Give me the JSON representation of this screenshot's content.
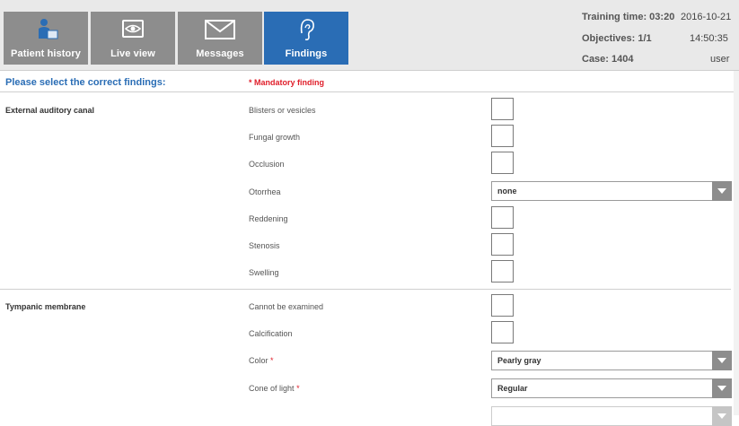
{
  "tabs": [
    {
      "label": "Patient history",
      "icon": "patient-history-icon",
      "active": false
    },
    {
      "label": "Live view",
      "icon": "eye-icon",
      "active": false
    },
    {
      "label": "Messages",
      "icon": "envelope-icon",
      "active": false
    },
    {
      "label": "Findings",
      "icon": "ear-icon",
      "active": true
    }
  ],
  "status": {
    "training_time_label": "Training time: 03:20",
    "date": "2016-10-21",
    "objectives_label": "Objectives: 1/1",
    "time": "14:50:35",
    "case_label": "Case: 1404",
    "user": "user"
  },
  "findings": {
    "title": "Please select the correct findings:",
    "mandatory_note": "* Mandatory finding",
    "sections": [
      {
        "label": "External auditory canal",
        "rows": [
          {
            "label": "Blisters or vesicles",
            "type": "checkbox"
          },
          {
            "label": "Fungal growth",
            "type": "checkbox"
          },
          {
            "label": "Occlusion",
            "type": "checkbox"
          },
          {
            "label": "Otorrhea",
            "type": "select",
            "value": "none"
          },
          {
            "label": "Reddening",
            "type": "checkbox"
          },
          {
            "label": "Stenosis",
            "type": "checkbox"
          },
          {
            "label": "Swelling",
            "type": "checkbox"
          }
        ]
      },
      {
        "label": "Tympanic membrane",
        "rows": [
          {
            "label": "Cannot be examined",
            "type": "checkbox"
          },
          {
            "label": "Calcification",
            "type": "checkbox"
          },
          {
            "label": "Color",
            "required_mark": "*",
            "type": "select",
            "value": "Pearly gray"
          },
          {
            "label": "Cone of light",
            "required_mark": "*",
            "type": "select",
            "value": "Regular"
          }
        ]
      }
    ]
  },
  "colors": {
    "accent": "#2a6db5",
    "tab_inactive": "#8d8d8d",
    "mandatory": "#e01e2a"
  }
}
